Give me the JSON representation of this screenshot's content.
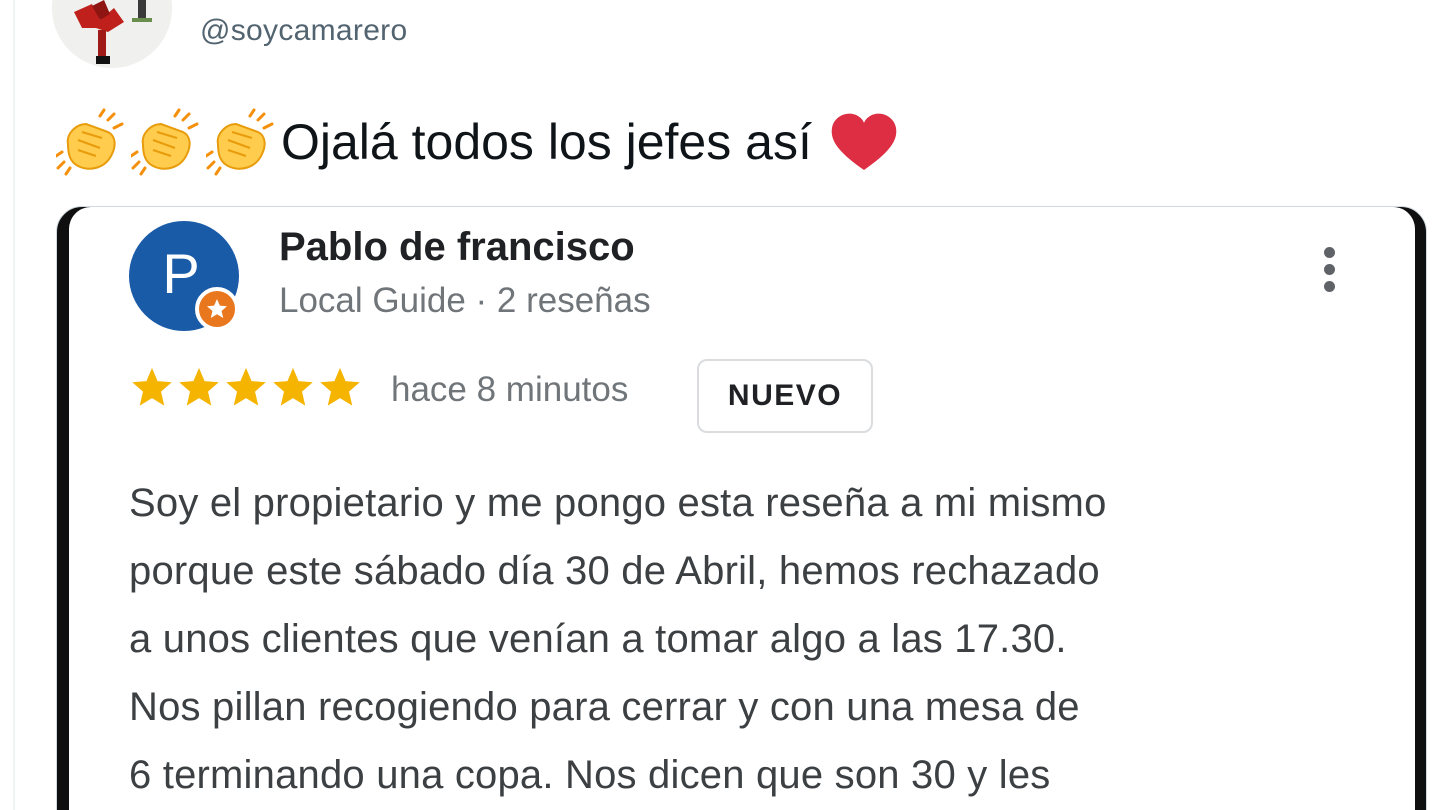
{
  "tweet": {
    "handle": "@soycamarero",
    "text": "Ojalá todos los jefes así",
    "emojis": [
      "clapping-hands-icon",
      "clapping-hands-icon",
      "clapping-hands-icon",
      "red-heart-icon"
    ]
  },
  "review": {
    "avatar_letter": "P",
    "reviewer_name": "Pablo de francisco",
    "reviewer_meta": "Local Guide · 2 reseñas",
    "rating": 5,
    "rating_max": 5,
    "time": "hace 8 minutos",
    "badge": "NUEVO",
    "body_lines": [
      "Soy el propietario y me pongo esta reseña a mi mismo",
      "porque este sábado día 30 de Abril, hemos rechazado",
      "a unos clientes que venían a tomar algo a las 17.30.",
      "Nos pillan recogiendo para cerrar y con una mesa de",
      "6 terminando una copa. Nos dicen que son 30 y les"
    ]
  },
  "colors": {
    "avatar_blue": "#1a5ba8",
    "guide_orange": "#e8771e",
    "star_gold": "#f4b400",
    "heart_red": "#dd2e44"
  }
}
